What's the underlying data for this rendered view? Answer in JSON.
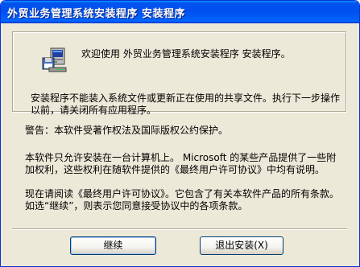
{
  "window": {
    "title": "外贸业务管理系统安装程序 安装程序"
  },
  "welcome": {
    "text": "欢迎使用 外贸业务管理系统安装程序 安装程序。",
    "warning": "安装程序不能装入系统文件或更新正在使用的共享文件。执行下一步操作以前，请关闭所有应用程序。"
  },
  "body": {
    "copyright": "警告：本软件受著作权法及国际版权公约保护。",
    "license_note": "本软件只允许安装在一台计算机上。 Microsoft 的某些产品提供了一些附加权利，这些权利在随软件提供的《最终用户许可协议》中均有说明。",
    "instructions": "现在请阅读《最终用户许可协议》。它包含了有关本软件产品的所有条款。如选“继续”，则表示您同意接受协议中的各项条款。"
  },
  "buttons": {
    "continue_label": "继续",
    "exit_label": "退出安装(X)"
  },
  "icons": {
    "setup": "setup-computer-icon"
  },
  "colors": {
    "titlebar": "#0053ee",
    "dialog_bg": "#ece9d8"
  }
}
